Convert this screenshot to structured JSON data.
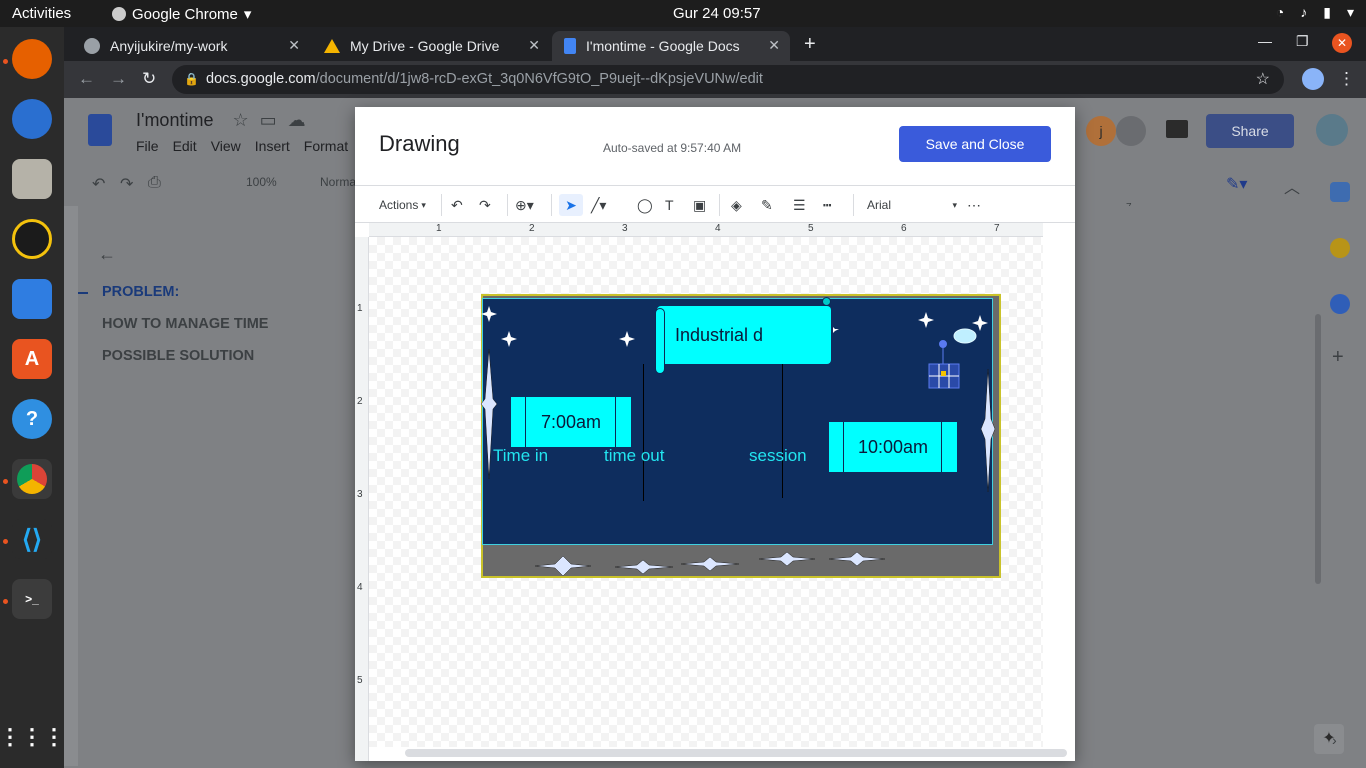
{
  "system": {
    "activities": "Activities",
    "app_name": "Google Chrome",
    "clock": "Gur 24  09:57"
  },
  "tabs": [
    {
      "title": "Anyijukire/my-work"
    },
    {
      "title": "My Drive - Google Drive"
    },
    {
      "title": "I'montime - Google Docs"
    }
  ],
  "omnibox": {
    "host": "docs.google.com",
    "path": "/document/d/1jw8-rcD-exGt_3q0N6VfG9tO_P9uejt--dKpsjeVUNw/edit"
  },
  "docs": {
    "title": "I'montime",
    "menus": [
      "File",
      "Edit",
      "View",
      "Insert",
      "Format"
    ],
    "zoom": "100%",
    "style": "Normal",
    "share_label": "Share",
    "outline": [
      {
        "text": "PROBLEM:"
      },
      {
        "text": "HOW TO MANAGE TIME"
      },
      {
        "text": "POSSIBLE SOLUTION"
      }
    ],
    "ruler_right": "7"
  },
  "drawing_dialog": {
    "title": "Drawing",
    "autosave": "Auto-saved at 9:57:40 AM",
    "save_close": "Save and Close",
    "actions": "Actions",
    "font": "Arial",
    "hruler": [
      "1",
      "2",
      "3",
      "4",
      "5",
      "6",
      "7"
    ],
    "vruler": [
      "1",
      "2",
      "3",
      "4",
      "5"
    ]
  },
  "drawing": {
    "banner_text": "Industrial d",
    "box1": "7:00am",
    "box2": "10:00am",
    "labels": [
      "Time in",
      "time out",
      "session"
    ],
    "colors": {
      "background": "#0e2d5e",
      "box": "#00ffff",
      "label": "#22e5f0",
      "bottom_band": "#6a6a6a"
    }
  }
}
